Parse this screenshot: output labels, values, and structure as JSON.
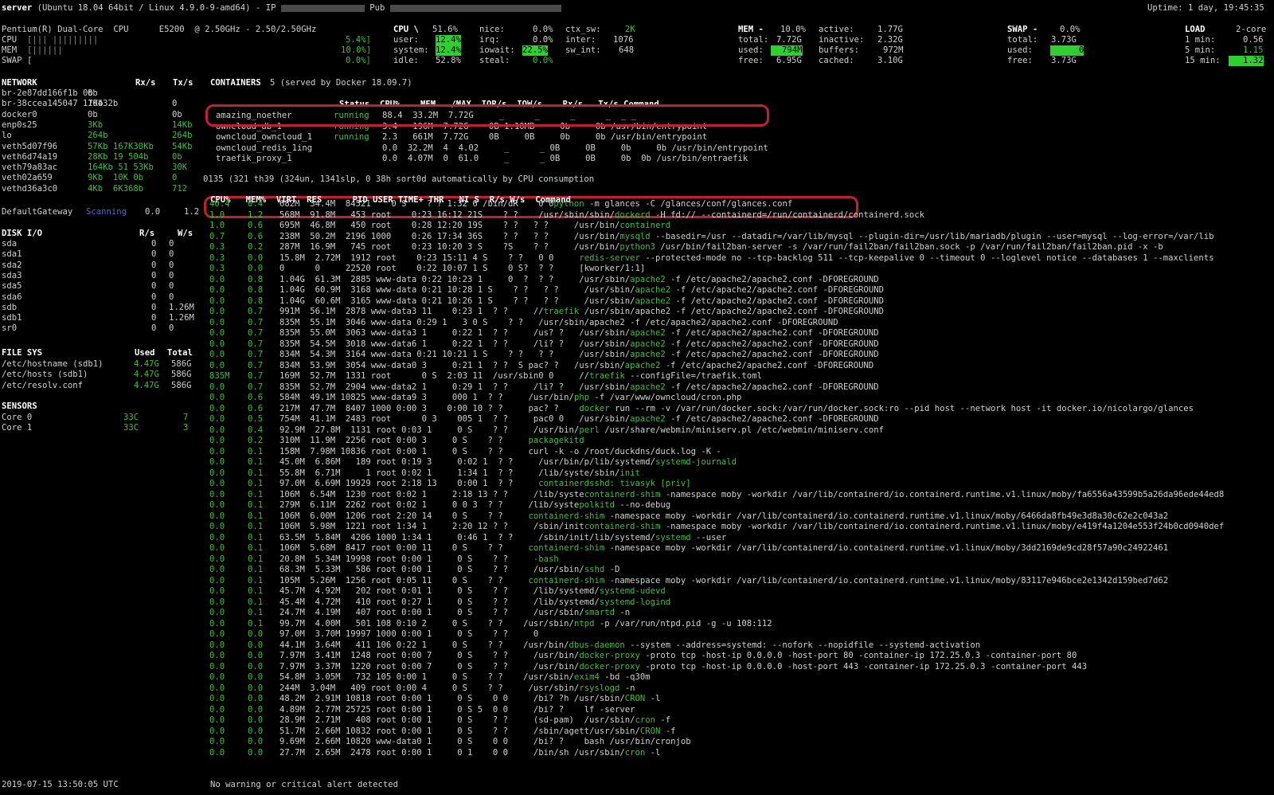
{
  "header": {
    "host": "server",
    "os": "(Ubuntu 18.04 64bit / Linux 4.9.0-9-amd64)",
    "ip_label": "- IP",
    "pub_label": "Pub",
    "uptime": "Uptime: 1 day, 19:45:35"
  },
  "quicklook": {
    "cpu_name": "Pentium(R) Dual-Core  CPU      E5200  @ 2.50GHz - 2.50/2.50GHz",
    "bars": [
      {
        "label": "CPU",
        "bar": "[||| |||||||||",
        "value": "5.4%]"
      },
      {
        "label": "MEM",
        "bar": "[||||||",
        "value": "10.0%]"
      },
      {
        "label": "SWAP",
        "bar": "[",
        "value": "0.0%]"
      }
    ]
  },
  "cpu": {
    "title": "CPU \\",
    "total": "51.6%",
    "rows": [
      {
        "k1": "user:",
        "v1": "12.4%",
        "k2": "irq:",
        "v2": "0.0%",
        "k3": "inter:",
        "v3": "1076"
      },
      {
        "k1": "system:",
        "v1": "12.4%",
        "k2": "iowait:",
        "v2": "22.5%",
        "k3": "sw_int:",
        "v3": "648"
      },
      {
        "k1": "idle:",
        "v1": "52.8%",
        "k2": "steal:",
        "v2": "0.0%",
        "k3": "",
        "v3": ""
      }
    ],
    "nice_label": "nice:",
    "nice": "0.0%",
    "ctx_label": "ctx_sw:",
    "ctx": "2K"
  },
  "mem": {
    "title": "MEM -",
    "pct": "10.0%",
    "total_label": "total:",
    "total": "7.72G",
    "used_label": "used:",
    "used": "794M",
    "free_label": "free:",
    "free": "6.95G",
    "active_label": "active:",
    "active": "1.77G",
    "inactive_label": "inactive:",
    "inactive": "2.32G",
    "buffers_label": "buffers:",
    "buffers": "972M",
    "cached_label": "cached:",
    "cached": "3.10G"
  },
  "swap": {
    "title": "SWAP -",
    "pct": "0.0%",
    "total_label": "total:",
    "total": "3.73G",
    "used_label": "used:",
    "used": "0",
    "free_label": "free:",
    "free": "3.73G"
  },
  "load": {
    "title": "LOAD",
    "cores": "2-core",
    "m1_label": "1 min:",
    "m1": "0.56",
    "m5_label": "5 min:",
    "m5": "1.15",
    "m15_label": "15 min:",
    "m15": "1.32"
  },
  "network": {
    "header": "NETWORK",
    "rx": "Rx/s",
    "tx": "Tx/s",
    "rows": [
      [
        "br-2e87dd166f1b 0b",
        "0b",
        ""
      ],
      [
        "br-38ccea145047 17Kb",
        "10432b",
        "0"
      ],
      [
        "docker0",
        "0b",
        "0b"
      ],
      [
        "enp0s25",
        "3Kb",
        "14Kb"
      ],
      [
        "lo",
        "264b",
        "264b"
      ],
      [
        "veth5d07f96",
        "57Kb 167K30Kb",
        "54Kb"
      ],
      [
        "veth6d74a19",
        "28Kb 19 504b",
        "0b"
      ],
      [
        "veth79a83ac",
        "164Kb 51 53Kb",
        "30K"
      ],
      [
        "veth02a659",
        "9Kb  10K 0b",
        "0"
      ],
      [
        "vethd36a3c0",
        "4Kb  6K368b",
        "712"
      ]
    ],
    "gateway_label": "DefaultGateway",
    "gateway_state": "Scanning",
    "gateway_v1": "0.0",
    "gateway_v2": "1.2"
  },
  "containers": {
    "title": "CONTAINERS",
    "count": "5 (served by Docker 18.09.7)",
    "columns": "Status  CPU%    MEM   /MAX  IOR/s  IOW/s    Rx/s   Tx/s Command",
    "rows": [
      {
        "name": "amazing_noether",
        "status": "running",
        "rest": "88.4  33.2M  7.72G     _      _      _      _  _ _"
      },
      {
        "name": "owncloud_db_1",
        "status": "running",
        "rest": "3.4   196M  7.72G    0B 1.10MB     0b     0b /usr/bin/entrypoint"
      },
      {
        "name": "owncloud_owncloud_1",
        "status": "running",
        "rest": "2.3   661M  7.72G    0B     0B     0b     0b /usr/bin/entrypoint"
      },
      {
        "name": "owncloud_redis_1ing",
        "status": "",
        "rest": "0.0  32.2M  4  4.02     _      _ 0B     0B     0b     0b /usr/bin/entrypoint"
      },
      {
        "name": "traefik_proxy_1",
        "status": "",
        "rest": "0.0  4.07M  0  61.0     _      _ 0B     0B     0b  0b /usr/bin/entraefik"
      }
    ],
    "tasks": "0135 (321 th39 (324un, 1341slp, 0 38h sort0d automatically by CPU consumption"
  },
  "process_header": "CPU%   MEM%  VIRT  RES      PID USER TIME+ THR   NI S  R/s W/s  Command",
  "processes": [
    {
      "cpu": "40.4",
      "mem": "0.4",
      "cols": "682M  34.4M  84521    0 S    ? ? 1:32 6 /bin/dR    0 0",
      "cmd_g": "python",
      "cmd": " -m glances -C /glances/conf/glances.conf"
    },
    {
      "cpu": "1.0",
      "mem": "1.2",
      "cols": "568M  91.8M   453 root    0:23 16:12 21S    ? ?    /usr/sbin/sbin/",
      "cmd_g": "dockerd",
      "cmd": " -H fd:// --containerd=/run/containerd/containerd.sock"
    },
    {
      "cpu": "1.0",
      "mem": "0.6",
      "cols": "695M  46.8M   450 root    0:28 12:20 19S    ? ?   ? ?     /usr/bin/",
      "cmd_g": "containerd",
      "cmd": ""
    },
    {
      "cpu": "0.7",
      "mem": "0.6",
      "cols": "238M  50.2M  2196 1000    0:26 17:34 36S    ? ?   ? ?     /usr/bin/",
      "cmd_g": "mysqld",
      "cmd": " --basedir=/usr --datadir=/var/lib/mysql --plugin-dir=/usr/lib/mariadb/plugin --user=mysql --log-error=/var/lib"
    },
    {
      "cpu": "0.3",
      "mem": "0.2",
      "cols": "287M  16.9M   745 root    0:23 10:20 3 S    ?S    ? ?     /usr/bin/",
      "cmd_g": "python3",
      "cmd": " /usr/bin/fail2ban-server -s /var/run/fail2ban/fail2ban.sock -p /var/run/fail2ban/fail2ban.pid -x -b"
    },
    {
      "cpu": "0.3",
      "mem": "0.0",
      "cols": "15.8M  2.72M  1912 root    0:23 15:11 4 S    ? ?   0 0     ",
      "cmd_g": "redis-server",
      "cmd": " --protected-mode no --tcp-backlog 511 --tcp-keepalive 0 --timeout 0 --loglevel notice --databases 1 --maxclients"
    },
    {
      "cpu": "0.3",
      "mem": "0.0",
      "cols": "0      0     22520 root    0:22 10:07 1 S    0 S?  ? ?     [kworker/1:1]",
      "cmd_g": "",
      "cmd": ""
    },
    {
      "cpu": "0.0",
      "mem": "0.8",
      "cols": "1.04G  61.3M  2885 www-data 0:22 10:23 1     0  ?  ? ?     /usr/sbin/",
      "cmd_g": "apache2",
      "cmd": " -f /etc/apache2/apache2.conf -DFOREGROUND"
    },
    {
      "cpu": "0.0",
      "mem": "0.8",
      "cols": "1.04G  60.9M  3168 www-data 0:21 10:28 1 S    ? ?   ? ?     /usr/sbin/",
      "cmd_g": "apache2",
      "cmd": " -f /etc/apache2/apache2.conf -DFOREGROUND"
    },
    {
      "cpu": "0.0",
      "mem": "0.8",
      "cols": "1.04G  60.6M  3165 www-data 0:21 10:26 1 S    ? ?   ? ?     /usr/sbin/",
      "cmd_g": "apache2",
      "cmd": " -f /etc/apache2/apache2.conf -DFOREGROUND"
    },
    {
      "cpu": "0.0",
      "mem": "0.7",
      "cols": "991M  56.1M  2878 www-data3 11    0:23 1  ? ?     //",
      "cmd_g": "traefik",
      "cmd": " /usr/sbin/apache2 -f /etc/apache2/apache2.conf -DFOREGROUND"
    },
    {
      "cpu": "0.0",
      "mem": "0.7",
      "cols": "835M  55.1M  3046 www-data 0:29 1   3 0 S    ? ?   /usr/sbin/apache2 -f /etc/apache2/apache2.conf -DFOREGROUND",
      "cmd_g": "",
      "cmd": ""
    },
    {
      "cpu": "0.0",
      "mem": "0.7",
      "cols": "835M  55.0M  3063 www-data3 1     0:22 1  ? ?     /us? ?   /usr/sbin/",
      "cmd_g": "apache2",
      "cmd": " -f /etc/apache2/apache2.conf -DFOREGROUND"
    },
    {
      "cpu": "0.0",
      "mem": "0.7",
      "cols": "835M  54.5M  3018 www-data6 1     0:22 1  ? ?     /li? ?   /usr/sbin/",
      "cmd_g": "apache2",
      "cmd": " -f /etc/apache2/apache2.conf -DFOREGROUND"
    },
    {
      "cpu": "0.0",
      "mem": "0.7",
      "cols": "834M  54.3M  3164 www-data 0:21 10:21 1 S    ? ?   ? ?     /usr/sbin/",
      "cmd_g": "apache2",
      "cmd": " -f /etc/apache2/apache2.conf -DFOREGROUND"
    },
    {
      "cpu": "0.0",
      "mem": "0.7",
      "cols": "834M  53.9M  3054 www-data0 3     0:21 1  ? ?  S pac? ?   /usr/sbin/",
      "cmd_g": "apache2",
      "cmd": " -f /etc/apache2/apache2.conf -DFOREGROUND"
    },
    {
      "cpu": "835M",
      "mem": "0.7",
      "cols": "169M  52.7M  1331 root      0 S  2:03 11  /usr/sbin0 0     //",
      "cmd_g": "traefik",
      "cmd": " --configFile=/traefik.toml"
    },
    {
      "cpu": "0.0",
      "mem": "0.7",
      "cols": "835M  52.7M  2904 www-data2 1     0:29 1  ? ?     /li? ?   /usr/sbin/",
      "cmd_g": "apache2",
      "cmd": " -f /etc/apache2/apache2.conf -DFOREGROUND"
    },
    {
      "cpu": "0.0",
      "mem": "0.6",
      "cols": "584M  49.1M 10825 www-data9 3     000 1  ? ?     /usr/bin/",
      "cmd_g": "php",
      "cmd": " -f /var/www/owncloud/cron.php"
    },
    {
      "cpu": "0.0",
      "mem": "0.6",
      "cols": "217M  47.7M  8407 1000 0:00 3    0:00 10 ? ?     pac? ?    ",
      "cmd_g": "docker",
      "cmd": " run --rm -v /var/run/docker.sock:/var/run/docker.sock:ro --pid host --network host -it docker.io/nicolargo/glances"
    },
    {
      "cpu": "0.0",
      "mem": "0.5",
      "cols": "754M  41.1M  2483 root      0 3    005 1  ? ?     pac0 0   /usr/sbin/",
      "cmd_g": "apache2",
      "cmd": " -f /etc/apache2/apache2.conf -DFOREGROUND"
    },
    {
      "cpu": "0.0",
      "mem": "0.4",
      "cols": "92.9M  27.8M  1131 root 0:03 1     0 S    ? ?     /usr/bin/",
      "cmd_g": "perl",
      "cmd": " /usr/share/webmin/miniserv.pl /etc/webmin/miniserv.conf"
    },
    {
      "cpu": "0.0",
      "mem": "0.2",
      "cols": "310M  11.9M  2256 root 0:00 3     0 S    ? ?     ",
      "cmd_g": "packagekitd",
      "cmd": ""
    },
    {
      "cpu": "0.0",
      "mem": "0.1",
      "cols": "158M  7.98M 10836 root 0:00 1     0 S    ? ?     curl -k -o /root/duckdns/duck.log -K -",
      "cmd_g": "",
      "cmd": ""
    },
    {
      "cpu": "0.0",
      "mem": "0.1",
      "cols": "45.0M  6.86M   189 root 0:19 3     0:02 1  ? ?     /usr/bin/p/lib/systemd/",
      "cmd_g": "systemd-journald",
      "cmd": ""
    },
    {
      "cpu": "0.0",
      "mem": "0.1",
      "cols": "55.8M  6.71M     1 root 0:02 1     1:34 1  ? ?     /lib/syste/sbin/",
      "cmd_g": "init",
      "cmd": ""
    },
    {
      "cpu": "0.0",
      "mem": "0.1",
      "cols": "97.0M  6.69M 19929 root 2:18 13    0:00 1  ? ?     ",
      "cmd_g": "containerdsshd: tivasyk [priv]",
      "cmd": ""
    },
    {
      "cpu": "0.0",
      "mem": "0.1",
      "cols": "106M  6.54M  1230 root 0:02 1     2:18 13 ? ?     /lib/syste",
      "cmd_g": "containerd-shim",
      "cmd": " -namespace moby -workdir /var/lib/containerd/io.containerd.runtime.v1.linux/moby/fa6556a43599b5a26da96ede44ed8"
    },
    {
      "cpu": "0.0",
      "mem": "0.1",
      "cols": "279M  6.11M  2262 root 0:02 1     0 0 3  ? ?     /lib/syste",
      "cmd_g": "polkitd",
      "cmd": " --no-debug"
    },
    {
      "cpu": "0.0",
      "mem": "0.1",
      "cols": "106M  6.00M  1206 root 2:20 14    0 S    ? ?     ",
      "cmd_g": "containerd-shim",
      "cmd": " -namespace moby -workdir /var/lib/containerd/io.containerd.runtime.v1.linux/moby/6466da8fb49e3d8a30c62e2c043a2"
    },
    {
      "cpu": "0.0",
      "mem": "0.1",
      "cols": "106M  5.98M  1221 root 1:34 1     2:20 12 ? ?     /sbin/init",
      "cmd_g": "containerd-shim",
      "cmd": " -namespace moby -workdir /var/lib/containerd/io.containerd.runtime.v1.linux/moby/e419f4a1204e553f24b0cd0940def"
    },
    {
      "cpu": "0.0",
      "mem": "0.1",
      "cols": "63.5M  5.84M  4206 1000 1:34 1     0:46 1  ? ?     /sbin/init/lib/systemd/",
      "cmd_g": "systemd",
      "cmd": " --user"
    },
    {
      "cpu": "0.0",
      "mem": "0.1",
      "cols": "106M  5.68M  8417 root 0:00 11    0 S    ? ?     ",
      "cmd_g": "containerd-shim",
      "cmd": " -namespace moby -workdir /var/lib/containerd/io.containerd.runtime.v1.linux/moby/3dd2169de9cd28f57a90c24922461"
    },
    {
      "cpu": "0.0",
      "mem": "0.1",
      "cols": "20.8M  5.34M 19998 root 0:00 1     0 S    ? ?     ",
      "cmd_g": "-bash",
      "cmd": ""
    },
    {
      "cpu": "0.0",
      "mem": "0.1",
      "cols": "68.3M  5.33M   586 root 0:00 1     0 S    ? ?     /usr/sbin/",
      "cmd_g": "sshd",
      "cmd": " -D"
    },
    {
      "cpu": "0.0",
      "mem": "0.1",
      "cols": "105M  5.26M  1256 root 0:05 11    0 S    ? ?     ",
      "cmd_g": "containerd-shim",
      "cmd": " -namespace moby -workdir /var/lib/containerd/io.containerd.runtime.v1.linux/moby/83117e946bce2e1342d159bed7d62"
    },
    {
      "cpu": "0.0",
      "mem": "0.1",
      "cols": "45.7M  4.92M   202 root 0:01 1     0 S    ? ?     /lib/systemd/",
      "cmd_g": "systemd-udevd",
      "cmd": ""
    },
    {
      "cpu": "0.0",
      "mem": "0.1",
      "cols": "45.4M  4.72M   410 root 0:27 1     0 S    ? ?     /lib/systemd/",
      "cmd_g": "systemd-logind",
      "cmd": ""
    },
    {
      "cpu": "0.0",
      "mem": "0.1",
      "cols": "24.7M  4.19M   407 root 0:00 1     0 S    ? ?     /usr/sbin/",
      "cmd_g": "smartd",
      "cmd": " -n"
    },
    {
      "cpu": "0.0",
      "mem": "0.1",
      "cols": "99.7M  4.00M   501 108 0:10 2     0 S    ? ?    /usr/sbin/",
      "cmd_g": "ntpd",
      "cmd": " -p /var/run/ntpd.pid -g -u 108:112"
    },
    {
      "cpu": "0.0",
      "mem": "0.0",
      "cols": "97.0M  3.70M 19997 1000 0:00 1     0 S    ? ?     0",
      "cmd_g": "",
      "cmd": ""
    },
    {
      "cpu": "0.0",
      "mem": "0.0",
      "cols": "44.1M  3.64M   411 106 0:22 1     0 S    ? ?    /usr/bin/",
      "cmd_g": "dbus-daemon",
      "cmd": " --system --address=systemd: --nofork --nopidfile --systemd-activation"
    },
    {
      "cpu": "0.0",
      "mem": "0.0",
      "cols": "7.97M  3.41M  1248 root 0:00 7     0 S    ? ?     /usr/bin/",
      "cmd_g": "docker-proxy",
      "cmd": " -proto tcp -host-ip 0.0.0.0 -host-port 80 -container-ip 172.25.0.3 -container-port 80"
    },
    {
      "cpu": "0.0",
      "mem": "0.0",
      "cols": "7.97M  3.37M  1220 root 0:00 7     0 S    ? ?     /usr/bin/",
      "cmd_g": "docker-proxy",
      "cmd": " -proto tcp -host-ip 0.0.0.0 -host-port 443 -container-ip 172.25.0.3 -container-port 443"
    },
    {
      "cpu": "0.0",
      "mem": "0.0",
      "cols": "54.8M  3.05M   732 105 0:00 1     0 S    ? ?    /usr/sbin/",
      "cmd_g": "exim4",
      "cmd": " -bd -q30m"
    },
    {
      "cpu": "0.0",
      "mem": "0.0",
      "cols": "244M  3.04M   409 root 0:00 4     0 S    ? ?     /usr/sbin/",
      "cmd_g": "rsyslogd",
      "cmd": " -n"
    },
    {
      "cpu": "0.0",
      "mem": "0.0",
      "cols": "48.2M  2.91M 10818 root 0:00 1     0 S    0 0     /bi? ?h /usr/sbin/",
      "cmd_g": "CRON",
      "cmd": " -l"
    },
    {
      "cpu": "0.0",
      "mem": "0.0",
      "cols": "4.89M  2.77M 25725 root 0:00 1     0 S 5  0 0     /bi? ?    lf -server",
      "cmd_g": "",
      "cmd": ""
    },
    {
      "cpu": "0.0",
      "mem": "0.0",
      "cols": "28.9M  2.71M   408 root 0:00 1     0 S    ? ?     (sd-pam)  /usr/sbin/",
      "cmd_g": "cron",
      "cmd": " -f"
    },
    {
      "cpu": "0.0",
      "mem": "0.0",
      "cols": "51.7M  2.66M 10832 root 0:00 1     0 S    ? ?     /sbin/agett/usr/sbin/",
      "cmd_g": "CRON",
      "cmd": " -f"
    },
    {
      "cpu": "0.0",
      "mem": "0.0",
      "cols": "9.69M  2.66M 10820 www-data0 1     0 S    0 0     /bi? ?    bash /usr/bin/cronjob",
      "cmd_g": "",
      "cmd": ""
    },
    {
      "cpu": "0.0",
      "mem": "0.0",
      "cols": "27.7M  2.65M  2478 root 0:00 1     0 1    0 0     /bin/sh /usr/sbin/",
      "cmd_g": "cron",
      "cmd": " -l"
    }
  ],
  "diskio": {
    "header": "DISK I/O",
    "r": "R/s",
    "w": "W/s",
    "rows": [
      [
        "sda",
        "0",
        "0"
      ],
      [
        "sda1",
        "0",
        "0"
      ],
      [
        "sda2",
        "0",
        "0"
      ],
      [
        "sda3",
        "0",
        "0"
      ],
      [
        "sda5",
        "0",
        "0"
      ],
      [
        "sda6",
        "0",
        "0"
      ],
      [
        "sdb",
        "0",
        "1.26M"
      ],
      [
        "sdb1",
        "0",
        "1.26M"
      ],
      [
        "sr0",
        "0",
        "0"
      ]
    ]
  },
  "filesys": {
    "header": "FILE SYS",
    "used": "Used",
    "total": "Total",
    "rows": [
      [
        "/etc/hostname (sdb1)",
        "4.47G",
        "586G"
      ],
      [
        "/etc/hosts (sdb1)",
        "4.47G",
        "586G"
      ],
      [
        "/etc/resolv.conf",
        "4.47G",
        "586G"
      ]
    ]
  },
  "sensors": {
    "header": "SENSORS",
    "rows": [
      [
        "Core 0",
        "33C",
        "7"
      ],
      [
        "Core 1",
        "33C",
        "3"
      ]
    ]
  },
  "footer": {
    "datetime": "2019-07-15 13:50:05 UTC",
    "alert": "No warning or critical alert detected"
  }
}
